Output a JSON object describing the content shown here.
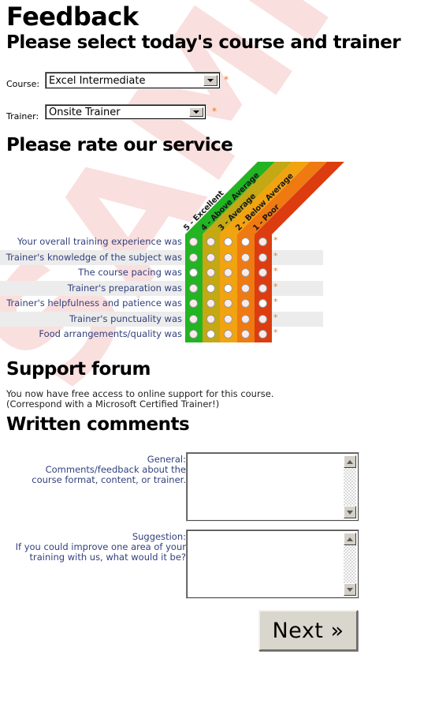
{
  "watermark": {
    "text": "SAMPLE",
    "color": "#fadfdf"
  },
  "headings": {
    "title": "Feedback",
    "subtitle": "Please select today's course and trainer",
    "rate": "Please rate our service",
    "support": "Support forum",
    "written": "Written comments"
  },
  "form": {
    "course_label": "Course:",
    "course_value": "Excel Intermediate",
    "trainer_label": "Trainer:",
    "trainer_value": "Onsite Trainer",
    "required_marker": "*"
  },
  "rating": {
    "scale": [
      {
        "value": 5,
        "label": "5 - Excellent",
        "color": "#22b422"
      },
      {
        "value": 4,
        "label": "4 - Above Average",
        "color": "#c4a814"
      },
      {
        "value": 3,
        "label": "3 - Average",
        "color": "#f2a310"
      },
      {
        "value": 2,
        "label": "2 - Below Average",
        "color": "#ef7a12"
      },
      {
        "value": 1,
        "label": "1 - Poor",
        "color": "#dc3c10"
      }
    ],
    "questions": [
      "Your overall training experience was",
      "Trainer's knowledge of the subject was",
      "The course pacing was",
      "Trainer's preparation was",
      "Trainer's helpfulness and patience was",
      "Trainer's punctuality was",
      "Food arrangements/quality was"
    ],
    "required_marker": "*"
  },
  "support": {
    "line1": "You now have free access to online support for this course.",
    "line2": "(Correspond with a Microsoft Certified Trainer!)"
  },
  "comments": {
    "general": {
      "caption": "General:",
      "hint_line1": "Comments/feedback about the",
      "hint_line2": "course format, content, or trainer.",
      "value": ""
    },
    "suggestion": {
      "caption": "Suggestion:",
      "hint_line1": "If you could improve one area of your",
      "hint_line2": "training with us, what would it be?",
      "value": ""
    }
  },
  "footer": {
    "next_label": "Next »"
  }
}
